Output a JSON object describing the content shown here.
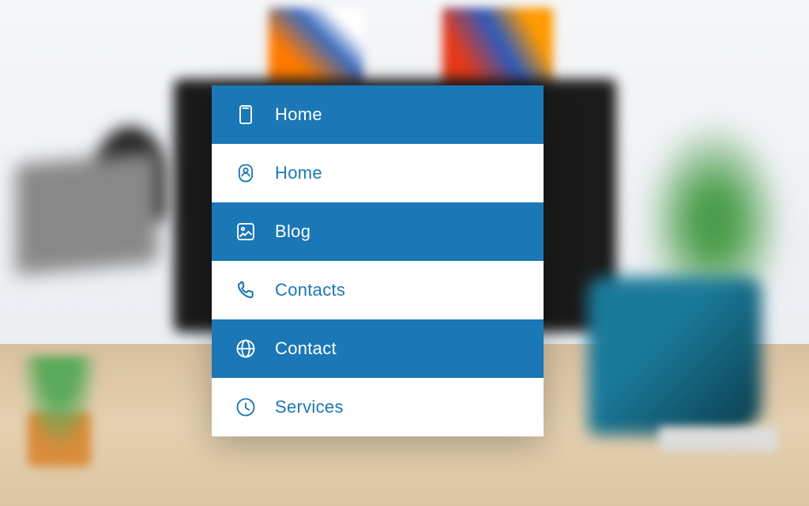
{
  "colors": {
    "accent": "#1b77b5",
    "white": "#ffffff"
  },
  "menu": {
    "items": [
      {
        "label": "Home",
        "icon": "device-icon",
        "variant": "blue"
      },
      {
        "label": "Home",
        "icon": "person-icon",
        "variant": "white"
      },
      {
        "label": "Blog",
        "icon": "image-icon",
        "variant": "blue"
      },
      {
        "label": "Contacts",
        "icon": "phone-icon",
        "variant": "white"
      },
      {
        "label": "Contact",
        "icon": "globe-icon",
        "variant": "blue"
      },
      {
        "label": "Services",
        "icon": "clock-icon",
        "variant": "white"
      }
    ]
  }
}
